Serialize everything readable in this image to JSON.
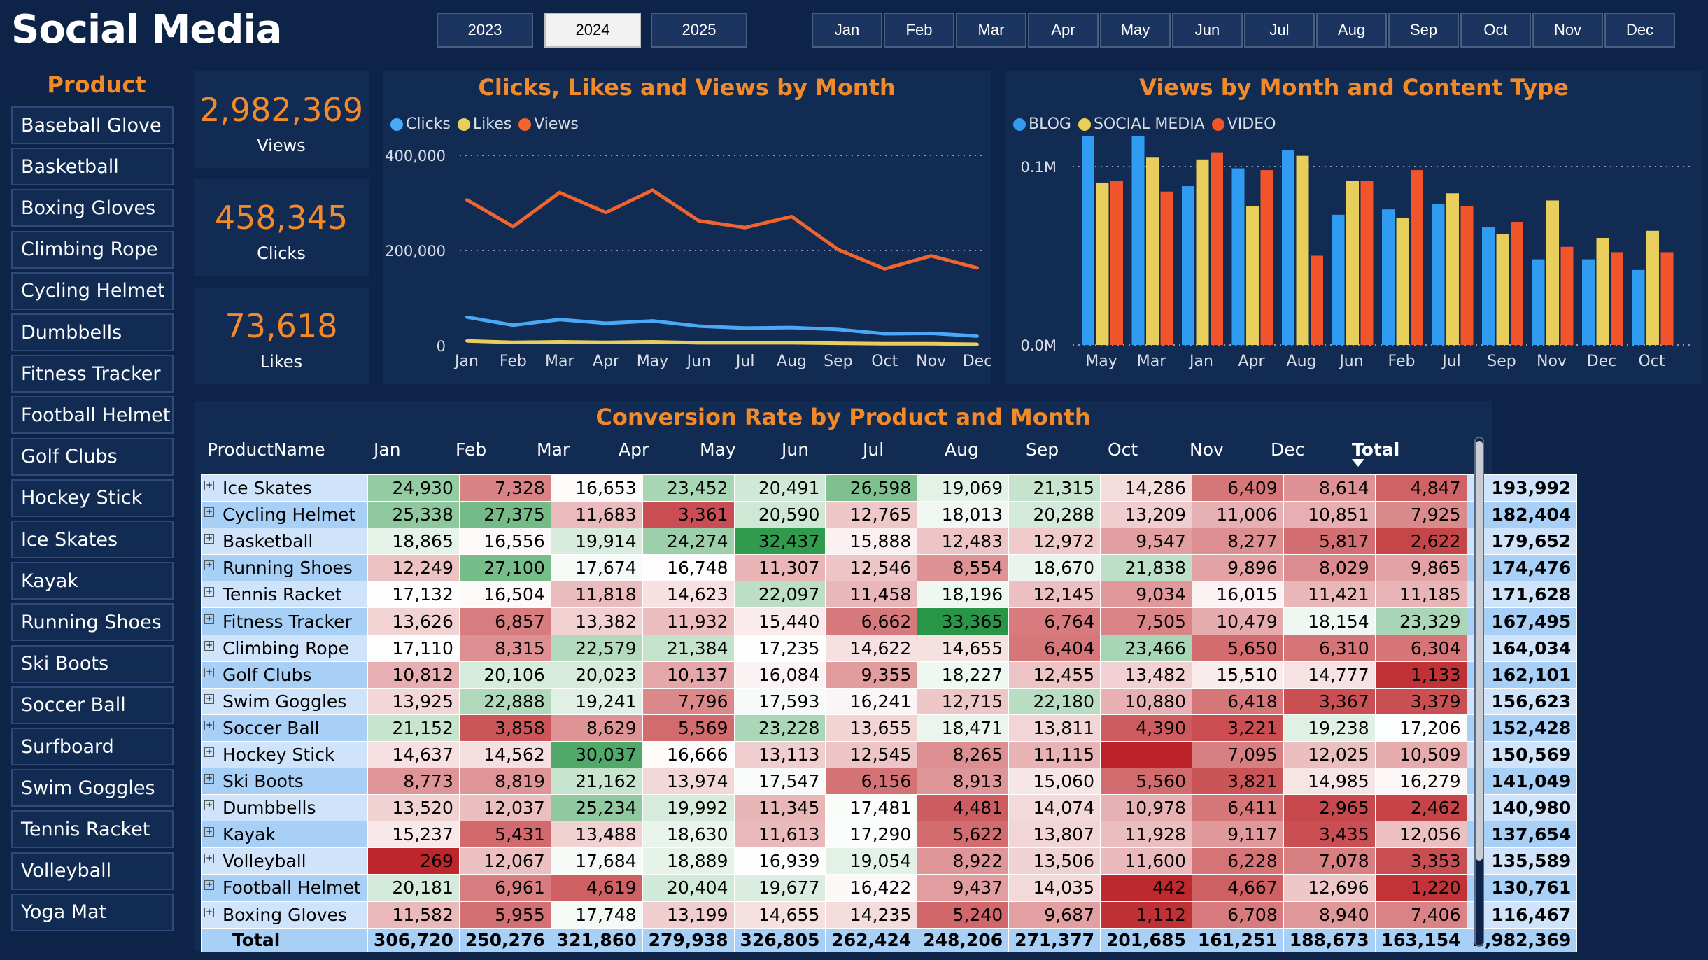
{
  "header": {
    "title": "Social Media"
  },
  "years": [
    {
      "label": "2023",
      "selected": false
    },
    {
      "label": "2024",
      "selected": true
    },
    {
      "label": "2025",
      "selected": false
    }
  ],
  "months_slicer": [
    "Jan",
    "Feb",
    "Mar",
    "Apr",
    "May",
    "Jun",
    "Jul",
    "Aug",
    "Sep",
    "Oct",
    "Nov",
    "Dec"
  ],
  "product_slicer": {
    "title": "Product",
    "items": [
      "Baseball Glove",
      "Basketball",
      "Boxing Gloves",
      "Climbing Rope",
      "Cycling Helmet",
      "Dumbbells",
      "Fitness Tracker",
      "Football Helmet",
      "Golf Clubs",
      "Hockey Stick",
      "Ice Skates",
      "Kayak",
      "Running Shoes",
      "Ski Boots",
      "Soccer Ball",
      "Surfboard",
      "Swim Goggles",
      "Tennis Racket",
      "Volleyball",
      "Yoga Mat"
    ]
  },
  "kpis": [
    {
      "value": "2,982,369",
      "label": "Views"
    },
    {
      "value": "458,345",
      "label": "Clicks"
    },
    {
      "value": "73,618",
      "label": "Likes"
    }
  ],
  "colors": {
    "clicks": "#4aa8f5",
    "likes": "#e8ce5a",
    "views": "#f0642f",
    "blog": "#2f9cf2",
    "social": "#e8ce5a",
    "video": "#f2552a",
    "accent": "#f28a2a"
  },
  "chart_data": [
    {
      "type": "line",
      "title": "Clicks, Likes and Views by Month",
      "categories": [
        "Jan",
        "Feb",
        "Mar",
        "Apr",
        "May",
        "Jun",
        "Jul",
        "Aug",
        "Sep",
        "Oct",
        "Nov",
        "Dec"
      ],
      "yticks": [
        "400,000",
        "200,000",
        "0"
      ],
      "ylim": [
        0,
        400000
      ],
      "legend_position": "top-left",
      "series": [
        {
          "name": "Clicks",
          "values": [
            60000,
            43000,
            55000,
            47000,
            52000,
            41000,
            37000,
            38000,
            34000,
            25000,
            26000,
            20000
          ]
        },
        {
          "name": "Likes",
          "values": [
            10000,
            7000,
            8000,
            7000,
            8000,
            6000,
            6000,
            6000,
            5000,
            4000,
            4000,
            3000
          ]
        },
        {
          "name": "Views",
          "values": [
            306720,
            250276,
            321860,
            279938,
            326805,
            262424,
            248206,
            271377,
            201685,
            161251,
            188673,
            163154
          ]
        }
      ]
    },
    {
      "type": "bar",
      "title": "Views by Month and Content Type",
      "categories": [
        "May",
        "Mar",
        "Jan",
        "Apr",
        "Aug",
        "Jun",
        "Feb",
        "Jul",
        "Sep",
        "Nov",
        "Dec",
        "Oct"
      ],
      "yticks": [
        "0.1M",
        "0.0M"
      ],
      "ylim": [
        0,
        0.15
      ],
      "legend_position": "top-left",
      "series": [
        {
          "name": "BLOG",
          "values": [
            0.139,
            0.126,
            0.089,
            0.099,
            0.109,
            0.073,
            0.076,
            0.079,
            0.066,
            0.048,
            0.048,
            0.042
          ]
        },
        {
          "name": "SOCIAL MEDIA",
          "values": [
            0.091,
            0.105,
            0.104,
            0.078,
            0.106,
            0.092,
            0.071,
            0.085,
            0.062,
            0.081,
            0.06,
            0.064
          ]
        },
        {
          "name": "VIDEO",
          "values": [
            0.092,
            0.086,
            0.108,
            0.098,
            0.05,
            0.092,
            0.098,
            0.078,
            0.069,
            0.055,
            0.052,
            0.052
          ]
        }
      ]
    }
  ],
  "matrix": {
    "title": "Conversion Rate by Product and Month",
    "columns": [
      "ProductName",
      "Jan",
      "Feb",
      "Mar",
      "Apr",
      "May",
      "Jun",
      "Jul",
      "Aug",
      "Sep",
      "Oct",
      "Nov",
      "Dec",
      "Total"
    ],
    "rows": [
      {
        "name": "Ice Skates",
        "values": [
          "24,930",
          "7,328",
          "16,653",
          "23,452",
          "20,491",
          "26,598",
          "19,069",
          "21,315",
          "14,286",
          "6,409",
          "8,614",
          "4,847"
        ],
        "total": "193,992"
      },
      {
        "name": "Cycling Helmet",
        "values": [
          "25,338",
          "27,375",
          "11,683",
          "3,361",
          "20,590",
          "12,765",
          "18,013",
          "20,288",
          "13,209",
          "11,006",
          "10,851",
          "7,925"
        ],
        "total": "182,404"
      },
      {
        "name": "Basketball",
        "values": [
          "18,865",
          "16,556",
          "19,914",
          "24,274",
          "32,437",
          "15,888",
          "12,483",
          "12,972",
          "9,547",
          "8,277",
          "5,817",
          "2,622"
        ],
        "total": "179,652"
      },
      {
        "name": "Running Shoes",
        "values": [
          "12,249",
          "27,100",
          "17,674",
          "16,748",
          "11,307",
          "12,546",
          "8,554",
          "18,670",
          "21,838",
          "9,896",
          "8,029",
          "9,865"
        ],
        "total": "174,476"
      },
      {
        "name": "Tennis Racket",
        "values": [
          "17,132",
          "16,504",
          "11,818",
          "14,623",
          "22,097",
          "11,458",
          "18,196",
          "12,145",
          "9,034",
          "16,015",
          "11,421",
          "11,185"
        ],
        "total": "171,628"
      },
      {
        "name": "Fitness Tracker",
        "values": [
          "13,626",
          "6,857",
          "13,382",
          "11,932",
          "15,440",
          "6,662",
          "33,365",
          "6,764",
          "7,505",
          "10,479",
          "18,154",
          "23,329"
        ],
        "total": "167,495"
      },
      {
        "name": "Climbing Rope",
        "values": [
          "17,110",
          "8,315",
          "22,579",
          "21,384",
          "17,235",
          "14,622",
          "14,655",
          "6,404",
          "23,466",
          "5,650",
          "6,310",
          "6,304"
        ],
        "total": "164,034"
      },
      {
        "name": "Golf Clubs",
        "values": [
          "10,812",
          "20,106",
          "20,023",
          "10,137",
          "16,084",
          "9,355",
          "18,227",
          "12,455",
          "13,482",
          "15,510",
          "14,777",
          "1,133"
        ],
        "total": "162,101"
      },
      {
        "name": "Swim Goggles",
        "values": [
          "13,925",
          "22,888",
          "19,241",
          "7,796",
          "17,593",
          "16,241",
          "12,715",
          "22,180",
          "10,880",
          "6,418",
          "3,367",
          "3,379"
        ],
        "total": "156,623"
      },
      {
        "name": "Soccer Ball",
        "values": [
          "21,152",
          "3,858",
          "8,629",
          "5,569",
          "23,228",
          "13,655",
          "18,471",
          "13,811",
          "4,390",
          "3,221",
          "19,238",
          "17,206"
        ],
        "total": "152,428"
      },
      {
        "name": "Hockey Stick",
        "values": [
          "14,637",
          "14,562",
          "30,037",
          "16,666",
          "13,113",
          "12,545",
          "8,265",
          "11,115",
          "",
          "7,095",
          "12,025",
          "10,509"
        ],
        "total": "150,569"
      },
      {
        "name": "Ski Boots",
        "values": [
          "8,773",
          "8,819",
          "21,162",
          "13,974",
          "17,547",
          "6,156",
          "8,913",
          "15,060",
          "5,560",
          "3,821",
          "14,985",
          "16,279"
        ],
        "total": "141,049"
      },
      {
        "name": "Dumbbells",
        "values": [
          "13,520",
          "12,037",
          "25,234",
          "19,992",
          "11,345",
          "17,481",
          "4,481",
          "14,074",
          "10,978",
          "6,411",
          "2,965",
          "2,462"
        ],
        "total": "140,980"
      },
      {
        "name": "Kayak",
        "values": [
          "15,237",
          "5,431",
          "13,488",
          "18,630",
          "11,613",
          "17,290",
          "5,622",
          "13,807",
          "11,928",
          "9,117",
          "3,435",
          "12,056"
        ],
        "total": "137,654"
      },
      {
        "name": "Volleyball",
        "values": [
          "269",
          "12,067",
          "17,684",
          "18,889",
          "16,939",
          "19,054",
          "8,922",
          "13,506",
          "11,600",
          "6,228",
          "7,078",
          "3,353"
        ],
        "total": "135,589"
      },
      {
        "name": "Football Helmet",
        "values": [
          "20,181",
          "6,961",
          "4,619",
          "20,404",
          "19,677",
          "16,422",
          "9,437",
          "14,035",
          "442",
          "4,667",
          "12,696",
          "1,220"
        ],
        "total": "130,761"
      },
      {
        "name": "Boxing Gloves",
        "values": [
          "11,582",
          "5,955",
          "17,748",
          "13,199",
          "14,655",
          "14,235",
          "5,240",
          "9,687",
          "1,112",
          "6,708",
          "8,940",
          "7,406"
        ],
        "total": "116,467"
      }
    ],
    "total_row": {
      "name": "Total",
      "values": [
        "306,720",
        "250,276",
        "321,860",
        "279,938",
        "326,805",
        "262,424",
        "248,206",
        "271,377",
        "201,685",
        "161,251",
        "188,673",
        "163,154"
      ],
      "total": "2,982,369"
    }
  }
}
